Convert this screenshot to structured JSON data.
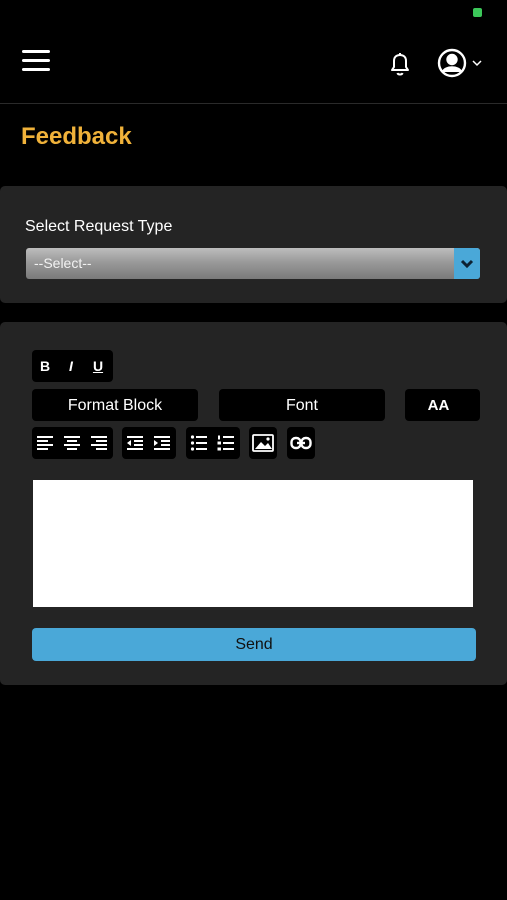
{
  "page": {
    "title": "Feedback"
  },
  "request_type": {
    "label": "Select Request Type",
    "selected": "--Select--"
  },
  "toolbar": {
    "bold": "B",
    "italic": "I",
    "underline": "U",
    "format_block": "Format Block",
    "font": "Font",
    "font_size": "AA"
  },
  "editor": {
    "value": ""
  },
  "send": {
    "label": "Send"
  },
  "colors": {
    "title": "#f0b23a",
    "accent": "#4aa8d8",
    "panel": "#242424",
    "background": "#000000"
  },
  "icons": [
    "menu-icon",
    "bell-icon",
    "user-icon",
    "chevron-down-icon"
  ]
}
